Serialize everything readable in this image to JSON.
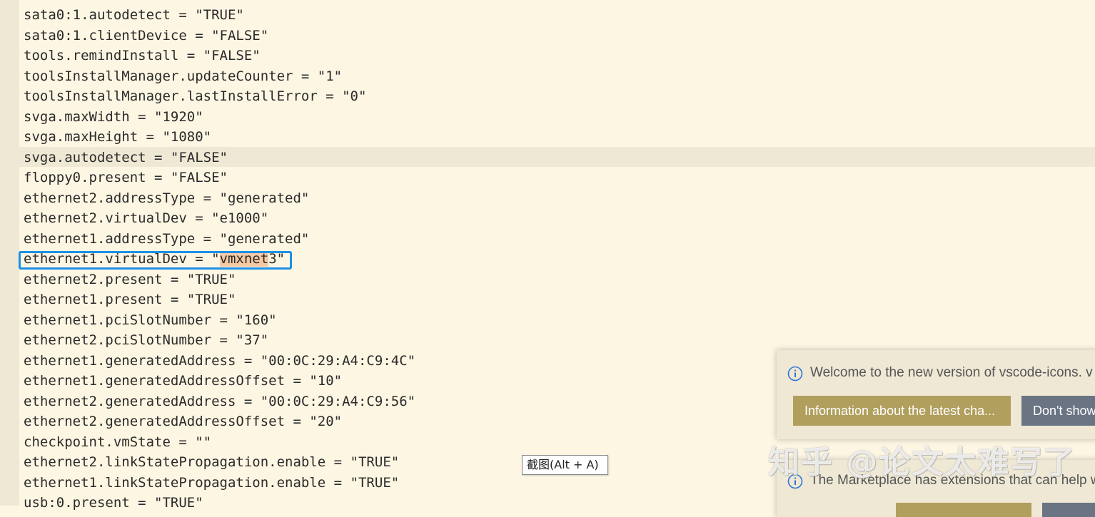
{
  "editor": {
    "lines": [
      "sata0:1.autodetect = \"TRUE\"",
      "sata0:1.clientDevice = \"FALSE\"",
      "tools.remindInstall = \"FALSE\"",
      "toolsInstallManager.updateCounter = \"1\"",
      "toolsInstallManager.lastInstallError = \"0\"",
      "svga.maxWidth = \"1920\"",
      "svga.maxHeight = \"1080\"",
      "svga.autodetect = \"FALSE\"",
      "floppy0.present = \"FALSE\"",
      "ethernet2.addressType = \"generated\"",
      "ethernet2.virtualDev = \"e1000\"",
      "ethernet1.addressType = \"generated\"",
      "ethernet1.virtualDev = \"vmxnet3\"",
      "ethernet2.present = \"TRUE\"",
      "ethernet1.present = \"TRUE\"",
      "ethernet1.pciSlotNumber = \"160\"",
      "ethernet2.pciSlotNumber = \"37\"",
      "ethernet1.generatedAddress = \"00:0C:29:A4:C9:4C\"",
      "ethernet1.generatedAddressOffset = \"10\"",
      "ethernet2.generatedAddress = \"00:0C:29:A4:C9:56\"",
      "ethernet2.generatedAddressOffset = \"20\"",
      "checkpoint.vmState = \"\"",
      "ethernet2.linkStatePropagation.enable = \"TRUE\"",
      "ethernet1.linkStatePropagation.enable = \"TRUE\"",
      "usb:0.present = \"TRUE\""
    ],
    "current_line": 7,
    "highlighted_line": 12,
    "highlight_text": "vmxnet"
  },
  "screenshot_tooltip": "截图(Alt + A)",
  "notifications": [
    {
      "icon": "info-icon",
      "message": "Welcome to the new version of vscode-icons. v",
      "primary_button": "Information about the latest cha...",
      "secondary_button": "Don't show"
    },
    {
      "icon": "info-icon",
      "message": "The Marketplace has extensions that can help w"
    }
  ],
  "watermark": "知乎 @论文太难写了",
  "colors": {
    "editor_bg": "#fdf6e3",
    "current_line_bg": "#eee8d5",
    "selection_border": "#1e90e6",
    "primary_button": "#b09f5d",
    "secondary_button": "#6a7482",
    "info_icon": "#2f77d1"
  }
}
